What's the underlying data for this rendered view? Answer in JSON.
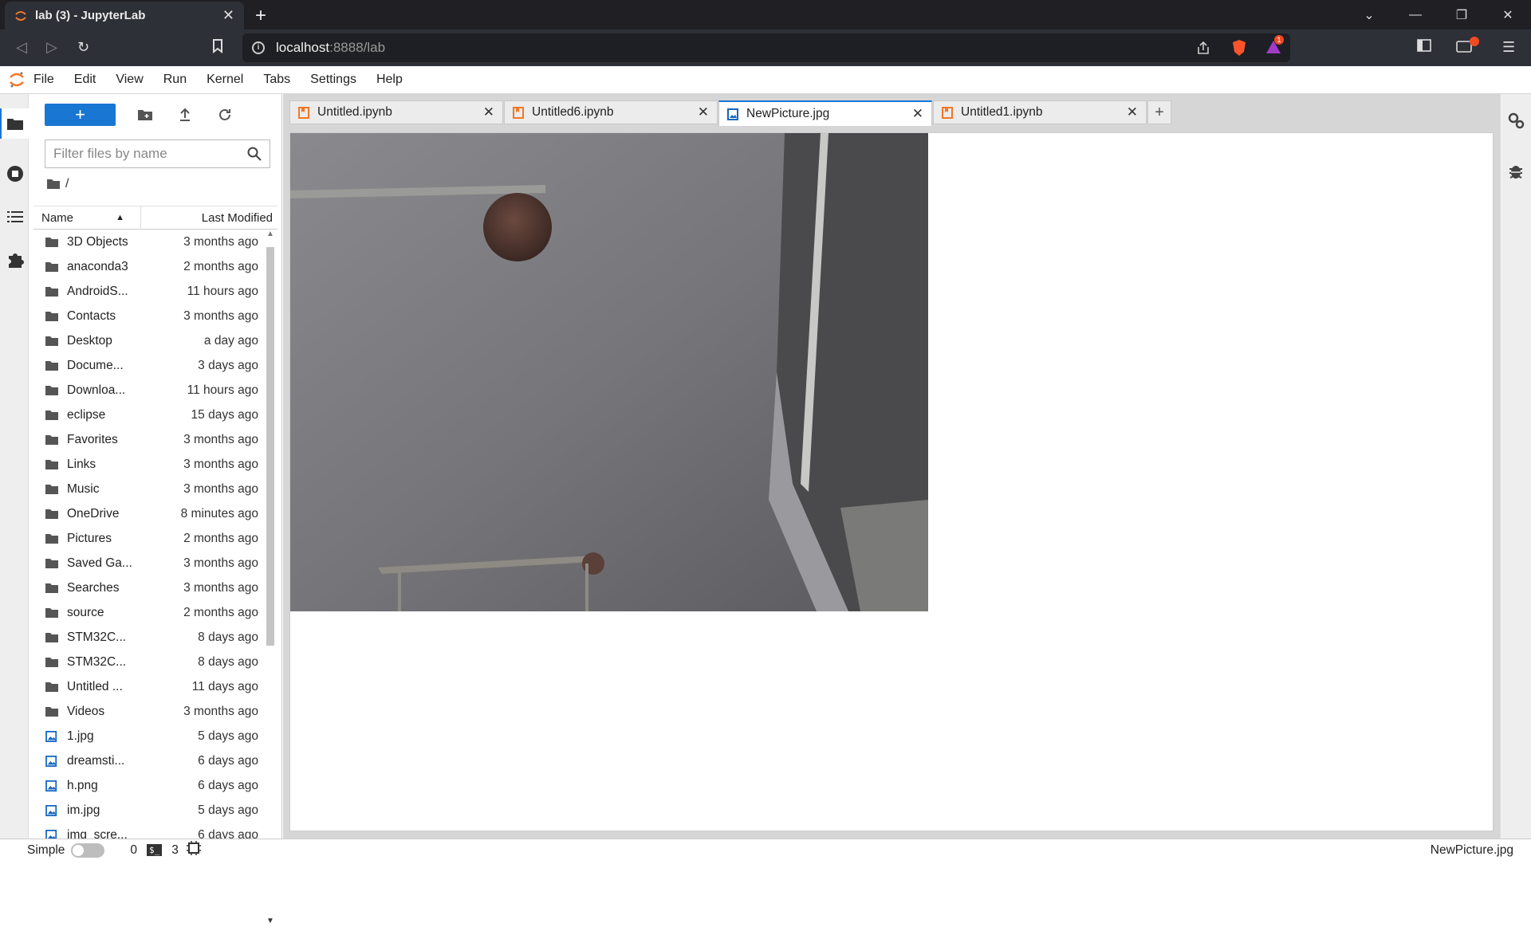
{
  "browser": {
    "tab_title": "lab (3) - JupyterLab",
    "url_host": "localhost",
    "url_rest": ":8888/lab",
    "notification_count": "1"
  },
  "menu": {
    "items": [
      "File",
      "Edit",
      "View",
      "Run",
      "Kernel",
      "Tabs",
      "Settings",
      "Help"
    ]
  },
  "filebrowser": {
    "filter_placeholder": "Filter files by name",
    "breadcrumb": "/",
    "col_name": "Name",
    "col_modified": "Last Modified",
    "items": [
      {
        "name": "3D Objects",
        "modified": "3 months ago",
        "type": "folder"
      },
      {
        "name": "anaconda3",
        "modified": "2 months ago",
        "type": "folder"
      },
      {
        "name": "AndroidS...",
        "modified": "11 hours ago",
        "type": "folder"
      },
      {
        "name": "Contacts",
        "modified": "3 months ago",
        "type": "folder"
      },
      {
        "name": "Desktop",
        "modified": "a day ago",
        "type": "folder"
      },
      {
        "name": "Docume...",
        "modified": "3 days ago",
        "type": "folder"
      },
      {
        "name": "Downloa...",
        "modified": "11 hours ago",
        "type": "folder"
      },
      {
        "name": "eclipse",
        "modified": "15 days ago",
        "type": "folder"
      },
      {
        "name": "Favorites",
        "modified": "3 months ago",
        "type": "folder"
      },
      {
        "name": "Links",
        "modified": "3 months ago",
        "type": "folder"
      },
      {
        "name": "Music",
        "modified": "3 months ago",
        "type": "folder"
      },
      {
        "name": "OneDrive",
        "modified": "8 minutes ago",
        "type": "folder"
      },
      {
        "name": "Pictures",
        "modified": "2 months ago",
        "type": "folder"
      },
      {
        "name": "Saved Ga...",
        "modified": "3 months ago",
        "type": "folder"
      },
      {
        "name": "Searches",
        "modified": "3 months ago",
        "type": "folder"
      },
      {
        "name": "source",
        "modified": "2 months ago",
        "type": "folder"
      },
      {
        "name": "STM32C...",
        "modified": "8 days ago",
        "type": "folder"
      },
      {
        "name": "STM32C...",
        "modified": "8 days ago",
        "type": "folder"
      },
      {
        "name": "Untitled ...",
        "modified": "11 days ago",
        "type": "folder"
      },
      {
        "name": "Videos",
        "modified": "3 months ago",
        "type": "folder"
      },
      {
        "name": "1.jpg",
        "modified": "5 days ago",
        "type": "image"
      },
      {
        "name": "dreamsti...",
        "modified": "6 days ago",
        "type": "image"
      },
      {
        "name": "h.png",
        "modified": "6 days ago",
        "type": "image"
      },
      {
        "name": "im.jpg",
        "modified": "5 days ago",
        "type": "image"
      },
      {
        "name": "img_scre...",
        "modified": "6 days ago",
        "type": "image"
      }
    ]
  },
  "dock": {
    "tabs": [
      {
        "label": "Untitled.ipynb",
        "type": "notebook",
        "active": false
      },
      {
        "label": "Untitled6.ipynb",
        "type": "notebook",
        "active": false
      },
      {
        "label": "NewPicture.jpg",
        "type": "image",
        "active": true
      },
      {
        "label": "Untitled1.ipynb",
        "type": "notebook",
        "active": false
      }
    ]
  },
  "status": {
    "mode_label": "Simple",
    "terminals_count": "0",
    "kernels_count": "3",
    "current_doc": "NewPicture.jpg"
  },
  "colors": {
    "accent": "#1976d2",
    "jupyter_orange": "#f37726",
    "browser_bg": "#1f1f24"
  }
}
